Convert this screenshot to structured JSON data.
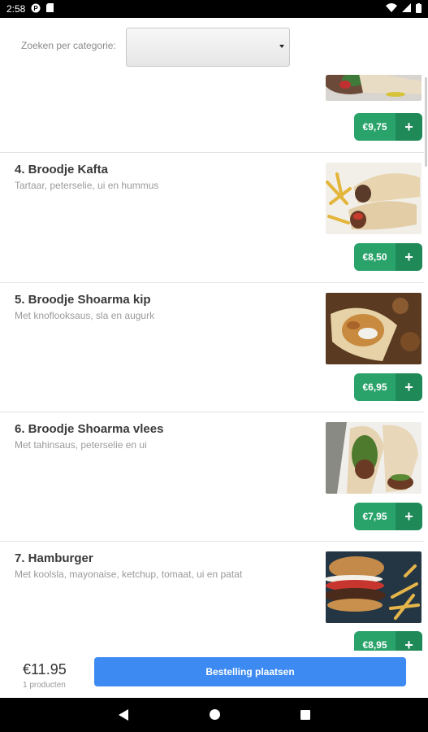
{
  "status_bar": {
    "time": "2:58",
    "left_icons": [
      "p-logo-icon",
      "sim-card-icon"
    ],
    "right_icons": [
      "wifi-icon",
      "signal-icon",
      "battery-icon"
    ]
  },
  "filter": {
    "label": "Zoeken per categorie:",
    "selected_value": ""
  },
  "items": [
    {
      "name": "",
      "description": "",
      "price": "€9,75",
      "photo": "wrap-icon"
    },
    {
      "name": "4. Broodje Kafta",
      "description": "Tartaar, peterselie, ui en hummus",
      "price": "€8,50",
      "photo": "kafta-wrap-fries-icon"
    },
    {
      "name": "5. Broodje Shoarma kip",
      "description": "Met knoflooksaus, sla en augurk",
      "price": "€6,95",
      "photo": "chicken-shoarma-icon"
    },
    {
      "name": "6. Broodje Shoarma vlees",
      "description": "Met tahinsaus, peterselie en ui",
      "price": "€7,95",
      "photo": "meat-shoarma-icon"
    },
    {
      "name": "7. Hamburger",
      "description": "Met koolsla, mayonaise, ketchup, tomaat, ui en patat",
      "price": "€8,95",
      "photo": "hamburger-icon"
    }
  ],
  "add_symbol": "+",
  "footer": {
    "total": "€11.95",
    "count": "1 producten",
    "order_button": "Bestelling plaatsen"
  },
  "colors": {
    "price_green": "#2aa36b",
    "plus_green": "#1f8a58",
    "order_blue": "#3d8bf2"
  }
}
